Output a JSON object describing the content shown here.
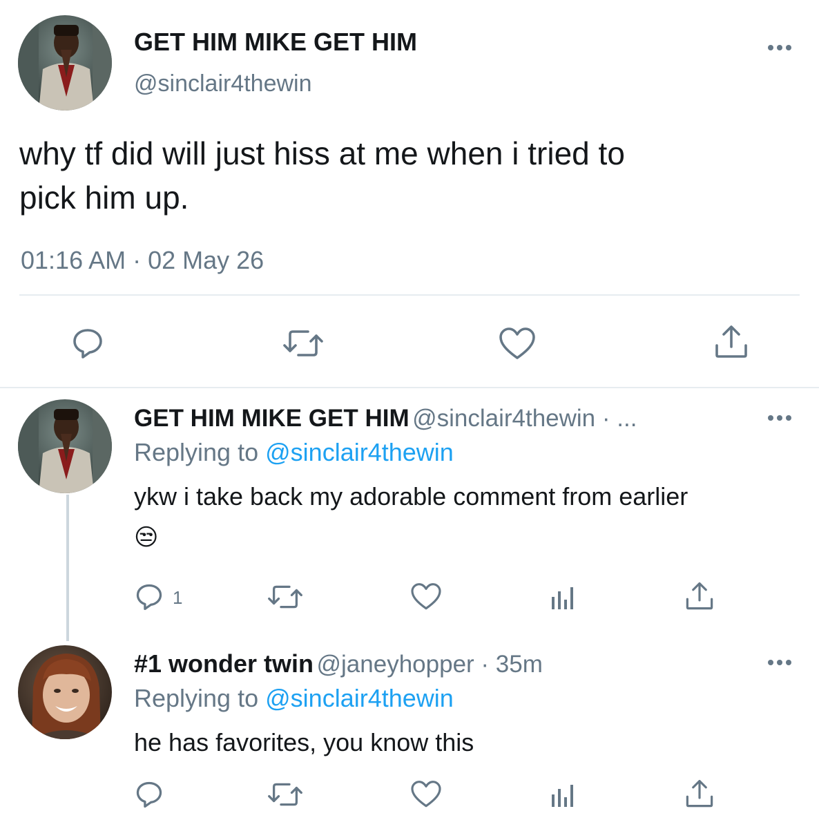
{
  "main_tweet": {
    "display_name": "GET HIM MIKE GET HIM",
    "handle": "@sinclair4thewin",
    "text_line1": "why tf did will just hiss at me when i tried to",
    "text_line2": "pick him up.",
    "timestamp": "01:16 AM · 02 May 26",
    "more_icon": "more-horizontal-icon",
    "actions": {
      "reply_icon": "comment-icon",
      "retweet_icon": "retweet-icon",
      "like_icon": "heart-icon",
      "share_icon": "share-icon"
    }
  },
  "replies": [
    {
      "display_name": "GET HIM MIKE GET HIM",
      "handle_meta": "@sinclair4thewin · ...",
      "replying_prefix": "Replying to",
      "replying_to": "@sinclair4thewin",
      "text": "ykw i take back my adorable comment from earlier",
      "emoji": "😒",
      "reply_count": "1"
    },
    {
      "display_name": "#1 wonder twin",
      "handle_meta": "@janeyhopper · 35m",
      "replying_prefix": "Replying to",
      "replying_to": "@sinclair4thewin",
      "text": "he has favorites, you know this",
      "reply_count": ""
    }
  ],
  "colors": {
    "text_primary": "#14171a",
    "text_secondary": "#657786",
    "link": "#1da1f2",
    "divider": "#e6ecf0"
  }
}
